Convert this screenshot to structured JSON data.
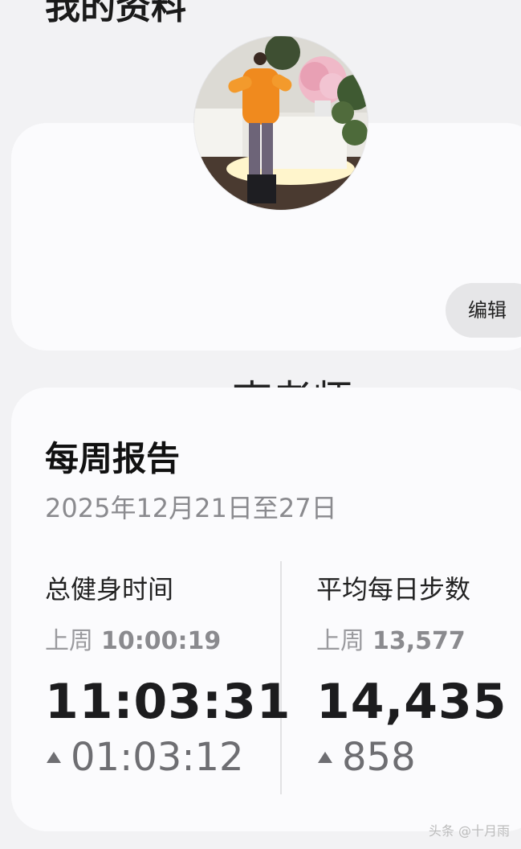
{
  "header": {
    "title": "我的资料"
  },
  "profile": {
    "name": "李老师",
    "edit_label": "编辑"
  },
  "report": {
    "title": "每周报告",
    "date_range": "2025年12月21日至27日",
    "workout": {
      "label": "总健身时间",
      "last_week_label": "上周",
      "last_week_value": "10:00:19",
      "value": "11:03:31",
      "change": "01:03:12"
    },
    "steps": {
      "label": "平均每日步数",
      "last_week_label": "上周",
      "last_week_value": "13,577",
      "value": "14,435",
      "change": "858"
    }
  },
  "watermark": "头条 @十月雨",
  "colors": {
    "background": "#f2f2f4",
    "card": "#fbfbfd",
    "edit_button": "#e6e6e8",
    "secondary_text": "#8a8a8e"
  }
}
